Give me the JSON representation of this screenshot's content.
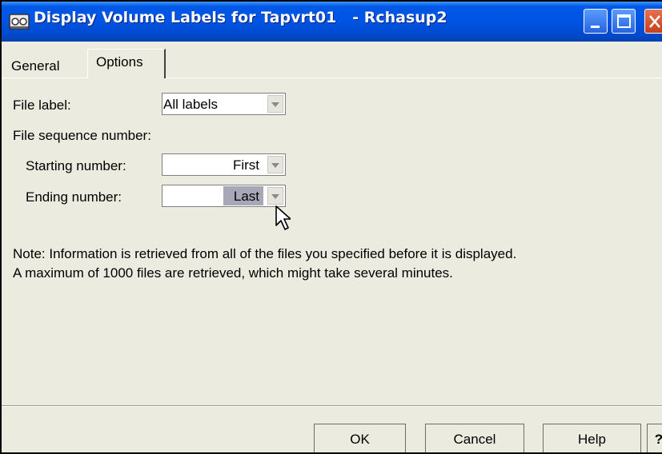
{
  "window": {
    "title": "Display Volume Labels for Tapvrt01   - Rchasup2",
    "app_icon": "tape-drive-icon",
    "controls": [
      "minimize-icon",
      "maximize-icon",
      "close-icon"
    ]
  },
  "tabs": [
    {
      "label": "General",
      "selected": false
    },
    {
      "label": "Options",
      "selected": true
    }
  ],
  "form": {
    "file_label": {
      "label": "File label:",
      "value": "All labels"
    },
    "file_sequence_heading": "File sequence number:",
    "starting_number": {
      "label": "Starting number:",
      "value": "First"
    },
    "ending_number": {
      "label": "Ending number:",
      "value": "Last"
    }
  },
  "note": {
    "line1": "Note:  Information is retrieved from all of the files you specified before it is displayed.",
    "line2": "A maximum of 1000 files are retrieved, which might take several minutes."
  },
  "buttons": {
    "ok": "OK",
    "cancel": "Cancel",
    "help": "Help",
    "question": "?"
  },
  "colors": {
    "titlebar": "#0054e3",
    "dialog_bg": "#ebebdf",
    "highlight": "#a7a7b7"
  }
}
